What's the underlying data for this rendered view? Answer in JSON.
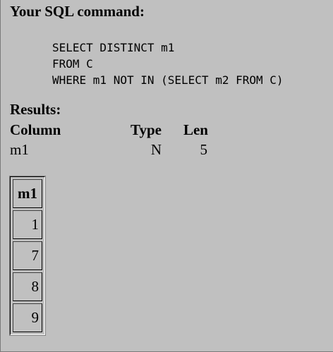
{
  "heading": "Your SQL command:",
  "sql_lines": [
    "SELECT DISTINCT m1",
    "FROM C",
    "WHERE m1 NOT IN (SELECT m2 FROM C)"
  ],
  "results_heading": "Results:",
  "metadata": {
    "headers": [
      "Column",
      "Type",
      "Len"
    ],
    "rows": [
      {
        "column": "m1",
        "type": "N",
        "len": "5"
      }
    ]
  },
  "result_table": {
    "header": "m1",
    "rows": [
      "1",
      "7",
      "8",
      "9"
    ]
  },
  "colors": {
    "background": "#c0c0c0"
  }
}
